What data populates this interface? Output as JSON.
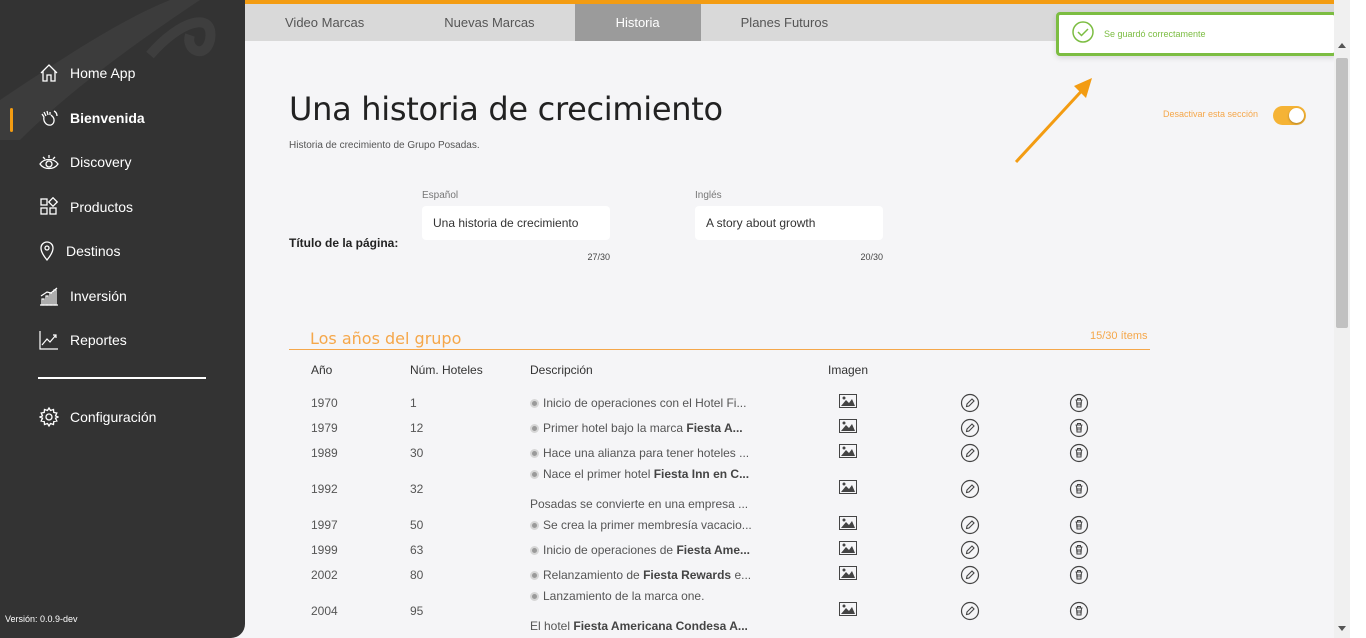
{
  "sidebar": {
    "items": [
      {
        "label": "Home App",
        "icon": "home-icon"
      },
      {
        "label": "Bienvenida",
        "icon": "wave-hand-icon",
        "active": true
      },
      {
        "label": "Discovery",
        "icon": "eye-icon"
      },
      {
        "label": "Productos",
        "icon": "grid-icon"
      },
      {
        "label": "Destinos",
        "icon": "map-pin-icon"
      },
      {
        "label": "Inversión",
        "icon": "bar-chart-icon"
      },
      {
        "label": "Reportes",
        "icon": "line-chart-icon"
      }
    ],
    "settings": {
      "label": "Configuración",
      "icon": "gear-icon"
    },
    "version": "Versión: 0.0.9-dev"
  },
  "tabs": [
    {
      "label": "Video Marcas"
    },
    {
      "label": "Nuevas Marcas"
    },
    {
      "label": "Historia",
      "active": true
    },
    {
      "label": "Planes Futuros"
    }
  ],
  "toast": {
    "message": "Se guardó correctamente",
    "icon": "check-circle-icon"
  },
  "page": {
    "title": "Una historia de crecimiento",
    "subtitle": "Historia de crecimiento de Grupo Posadas.",
    "toggle_label": "Desactivar esta sección",
    "toggle_on": true
  },
  "title_field": {
    "row_label": "Título de la página:",
    "es_label": "Español",
    "es_value": "Una historia de crecimiento",
    "es_count": "27/30",
    "en_label": "Inglés",
    "en_value": "A story about growth",
    "en_count": "20/30"
  },
  "section": {
    "title": "Los años del grupo",
    "count": "15/30 ítems",
    "columns": [
      "Año",
      "Núm. Hoteles",
      "Descripción",
      "Imagen"
    ]
  },
  "rows": [
    {
      "year": "1970",
      "hotels": "1",
      "desc": "Inicio de operaciones con el Hotel Fi..."
    },
    {
      "year": "1979",
      "hotels": "12",
      "desc_pre": "Primer hotel bajo la marca ",
      "desc_bold": "Fiesta A..."
    },
    {
      "year": "1989",
      "hotels": "30",
      "desc": "Hace una alianza para tener hoteles ..."
    },
    {
      "year": "1992",
      "hotels": "32",
      "desc_pre": "Nace el primer hotel ",
      "desc_bold": "Fiesta Inn en C...",
      "desc2": "Posadas se convierte en una empresa ..."
    },
    {
      "year": "1997",
      "hotels": "50",
      "desc": "Se crea la primer membresía vacacio..."
    },
    {
      "year": "1999",
      "hotels": "63",
      "desc_pre": "Inicio de operaciones de ",
      "desc_bold": "Fiesta Ame..."
    },
    {
      "year": "2002",
      "hotels": "80",
      "desc_pre": "Relanzamiento de ",
      "desc_bold": "Fiesta Rewards",
      "desc_post": " e..."
    },
    {
      "year": "2004",
      "hotels": "95",
      "desc": "Lanzamiento de la marca one.",
      "desc2_pre": "El hotel ",
      "desc2_bold": "Fiesta Americana Condesa A..."
    }
  ],
  "colors": {
    "accent": "#f39c12",
    "sidebar": "#333333",
    "success": "#7cbd42",
    "section": "#f5a74a"
  }
}
